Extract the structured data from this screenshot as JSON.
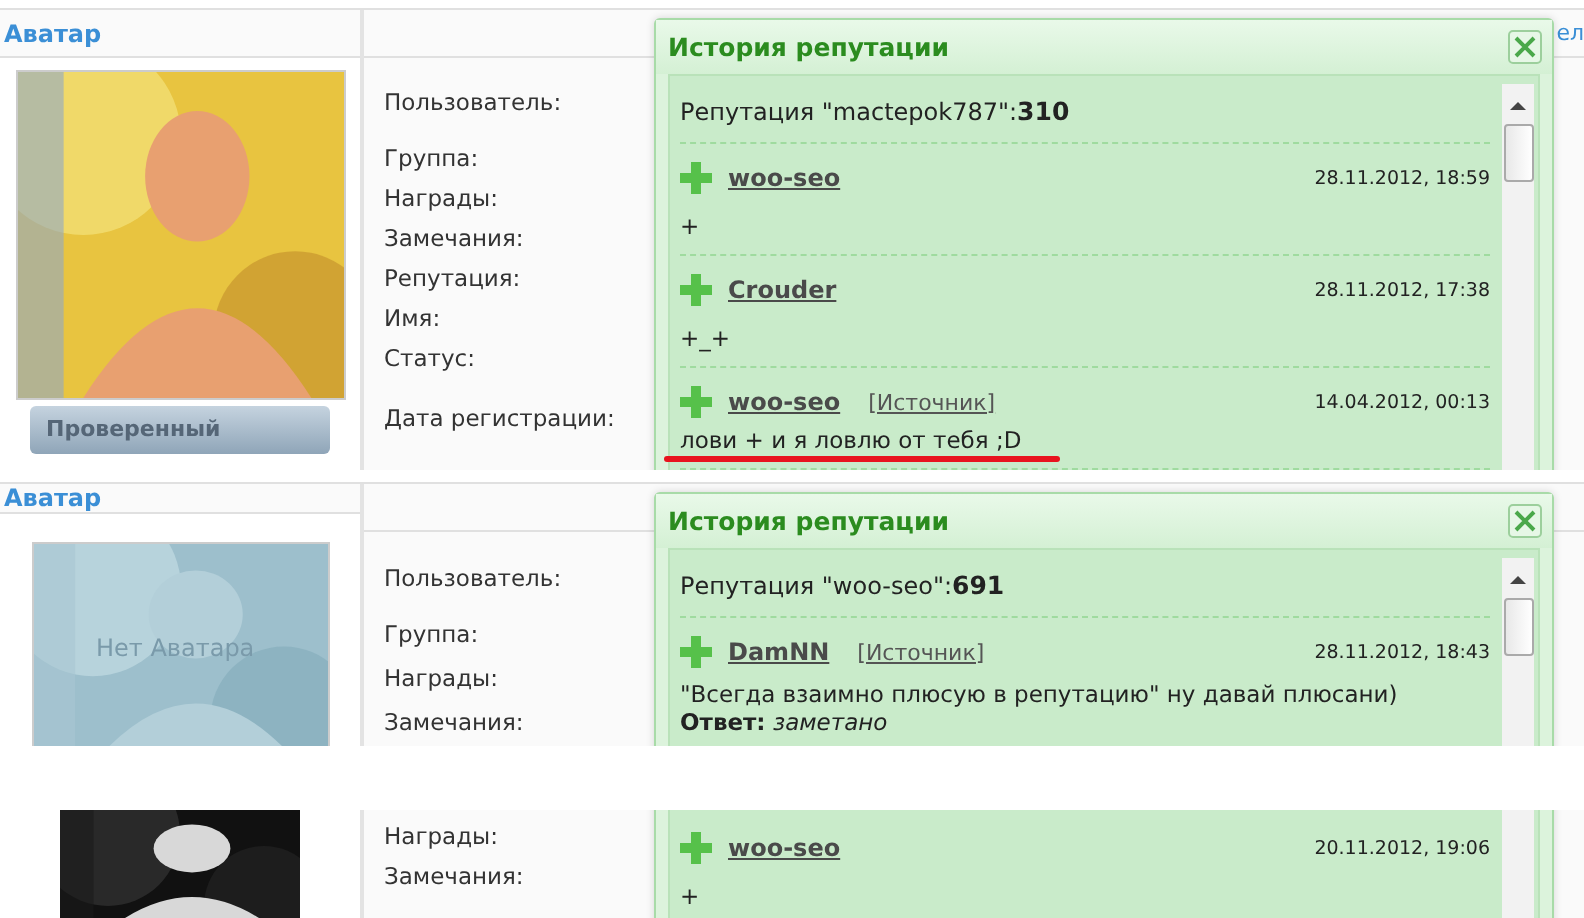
{
  "panels": [
    {
      "column_header": "Аватар",
      "tab_fragment": "ел",
      "badge": "Проверенный",
      "profile_labels": [
        "Пользователь:",
        "Группа:",
        "Награды:",
        "Замечания:",
        "Репутация:",
        "Имя:",
        "Статус:",
        "Дата регистрации:"
      ],
      "popup": {
        "title": "История репутации",
        "summary_label": "Репутация \"mactepok787\":",
        "summary_value": "310",
        "entries": [
          {
            "user": "woo-seo",
            "date": "28.11.2012, 18:59",
            "comment": "+",
            "underlined": false
          },
          {
            "user": "Crouder",
            "date": "28.11.2012, 17:38",
            "comment": "+_+",
            "underlined": false
          },
          {
            "user": "woo-seo",
            "source": "[Источник]",
            "date": "14.04.2012, 00:13",
            "comment": "лови + и я ловлю от тебя ;D",
            "underlined": true
          }
        ]
      }
    },
    {
      "column_header": "Аватар",
      "avatar": {
        "kind": "placeholder",
        "caption": "Нет Аватара"
      },
      "profile_labels": [
        "Пользователь:",
        "Группа:",
        "Награды:",
        "Замечания:"
      ],
      "popup": {
        "title": "История репутации",
        "summary_label": "Репутация \"woo-seo\":",
        "summary_value": "691",
        "entries": [
          {
            "user": "DamNN",
            "source": "[Источник]",
            "date": "28.11.2012, 18:43",
            "comment": "\"Всегда взаимно плюсую в репутацию\" ну давай плюсани)",
            "reply_label": "Ответ:",
            "reply": "заметано",
            "underlined": false
          }
        ]
      }
    },
    {
      "avatar": {
        "kind": "mono"
      },
      "profile_labels": [
        "Награды:",
        "Замечания:"
      ],
      "popup": {
        "entries": [
          {
            "user": "woo-seo",
            "date": "20.11.2012, 19:06",
            "comment": "+",
            "underlined": false
          }
        ]
      }
    }
  ]
}
